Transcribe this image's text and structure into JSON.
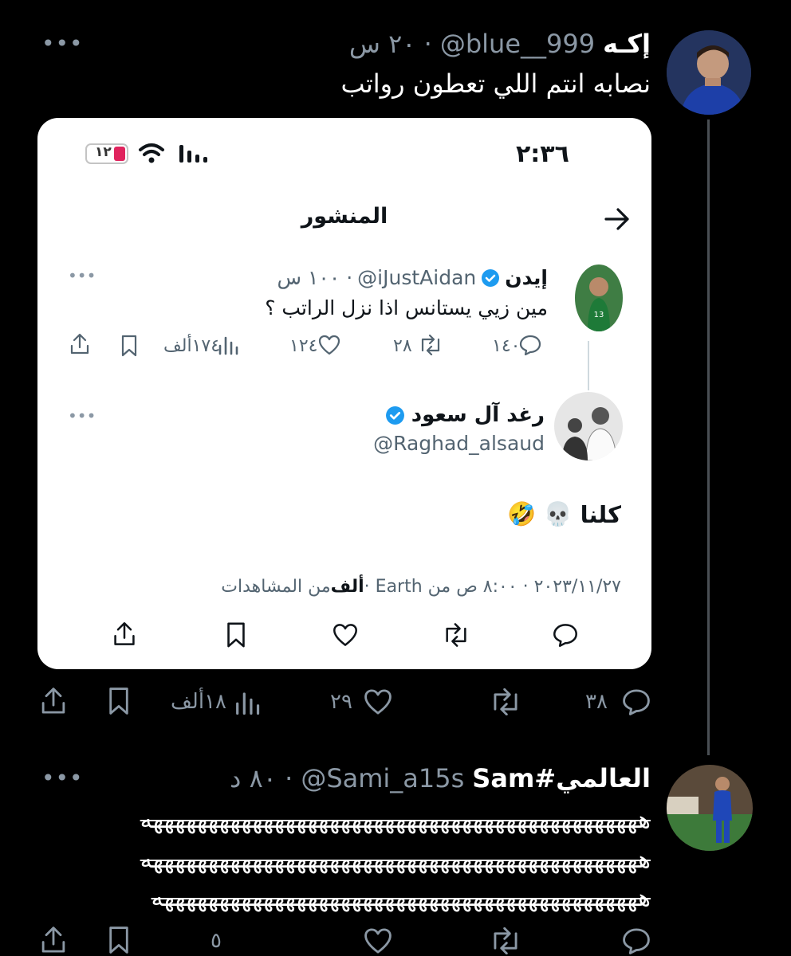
{
  "tweet1": {
    "name": "إكـه",
    "handle": "@blue__999",
    "time": "· ٢٠ س",
    "text": "نصابه انتم اللي تعطون رواتب",
    "more": "•••",
    "actions": {
      "replies": "٣٨",
      "retweets": "",
      "likes": "٢٩",
      "views": "١٨ألف"
    }
  },
  "card": {
    "status_time": "٢:٣٦",
    "battery": "١٢",
    "title": "المنشور",
    "quoted": {
      "name": "إيدن",
      "handle": "@iJustAidan",
      "time": "· ١٠٠ س",
      "text": "مين زيي يستانس اذا نزل الراتب ؟",
      "more": "•••",
      "replies": "١٤٠",
      "retweets": "٢٨",
      "likes": "١٢٤",
      "views": "١٧٤ألف"
    },
    "reply": {
      "name": "رغد آل سعود",
      "handle": "@Raghad_alsaud",
      "text": "كلنا",
      "emoji": "🤣 💀",
      "more": "•••",
      "meta_date": "٢٠٢٣/١١/٢٧ · ٨:٠٠ ص من Earth · ",
      "meta_views_bold": "ألف",
      "meta_views_rest": " من المشاهدات"
    }
  },
  "tweet2": {
    "name": "العالمي#Sam",
    "handle": "@Sami_a15s",
    "time": "· ٨٠ د",
    "more": "•••",
    "line1": "هههههههههههههههههههههههههههههههههههههههههههههه",
    "line2": "هههههههههههههههههههههههههههههههههههههههههههههه",
    "line3": "ههههههههههههههههههههههههههههههههههههههههههههه",
    "actions": {
      "likes": "٥"
    }
  },
  "colors": {
    "bg": "#000000",
    "card_bg": "#ffffff",
    "muted": "#8b98a5",
    "verified": "#1d9bf0",
    "battery": "#e0245e"
  }
}
